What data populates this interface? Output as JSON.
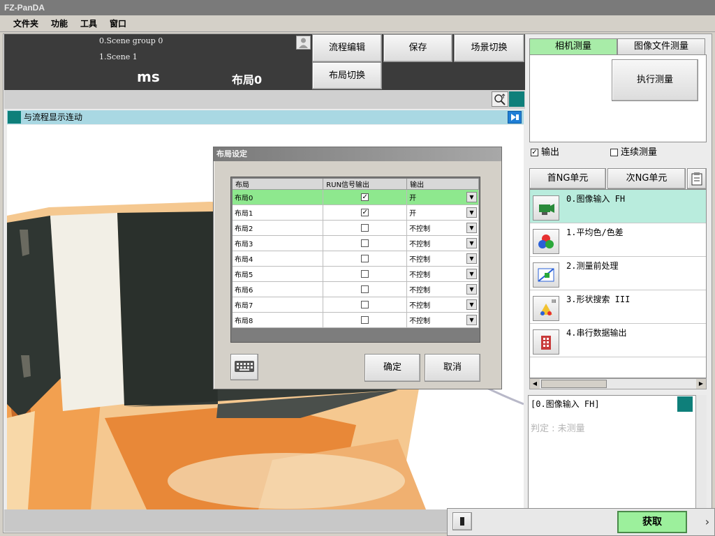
{
  "window": {
    "title": "FZ-PanDA"
  },
  "menu": {
    "items": [
      "文件夹",
      "功能",
      "工具",
      "窗口"
    ]
  },
  "header": {
    "scene_group": "0.Scene group 0",
    "scene": "1.Scene 1",
    "time_unit": "ms",
    "layout_name": "布局0",
    "buttons": {
      "flow_edit": "流程编辑",
      "save": "保存",
      "scene_switch": "场景切换",
      "layout_switch": "布局切换"
    }
  },
  "view": {
    "link_label": "与流程显示连动"
  },
  "dialog": {
    "title": "布局设定",
    "columns": [
      "布局",
      "RUN信号输出",
      "输出"
    ],
    "rows": [
      {
        "layout": "布局0",
        "run": "✓",
        "output": "开"
      },
      {
        "layout": "布局1",
        "run": "✓",
        "output": "开"
      },
      {
        "layout": "布局2",
        "run": "",
        "output": "不控制"
      },
      {
        "layout": "布局3",
        "run": "",
        "output": "不控制"
      },
      {
        "layout": "布局4",
        "run": "",
        "output": "不控制"
      },
      {
        "layout": "布局5",
        "run": "",
        "output": "不控制"
      },
      {
        "layout": "布局6",
        "run": "",
        "output": "不控制"
      },
      {
        "layout": "布局7",
        "run": "",
        "output": "不控制"
      },
      {
        "layout": "布局8",
        "run": "",
        "output": "不控制"
      }
    ],
    "ok": "确定",
    "cancel": "取消"
  },
  "right": {
    "tabs": [
      "相机测量",
      "图像文件测量"
    ],
    "execute": "执行测量",
    "output_checkbox": {
      "label": "输出",
      "checked": "✓"
    },
    "continuous_checkbox": {
      "label": "连续测量",
      "checked": ""
    },
    "first_ng": "首NG单元",
    "next_ng": "次NG单元",
    "flow": [
      {
        "label": "0.图像输入 FH",
        "icon": "camera-input-icon"
      },
      {
        "label": "1.平均色/色差",
        "icon": "color-circles-icon"
      },
      {
        "label": "2.测量前处理",
        "icon": "preprocess-icon"
      },
      {
        "label": "3.形状搜索 III",
        "icon": "shape-search-icon"
      },
      {
        "label": "4.串行数据输出",
        "icon": "serial-output-icon"
      }
    ],
    "detail_title": "[0.图像输入 FH]",
    "detail_result": "判定 : 未测量"
  },
  "footer": {
    "acquire": "获取",
    "more": "›"
  },
  "colors": {
    "selected_row": "#8ee88e",
    "active_tab": "#a8eca8",
    "teal": "#0e7f7a",
    "flow_selected": "#b9ecdd"
  }
}
